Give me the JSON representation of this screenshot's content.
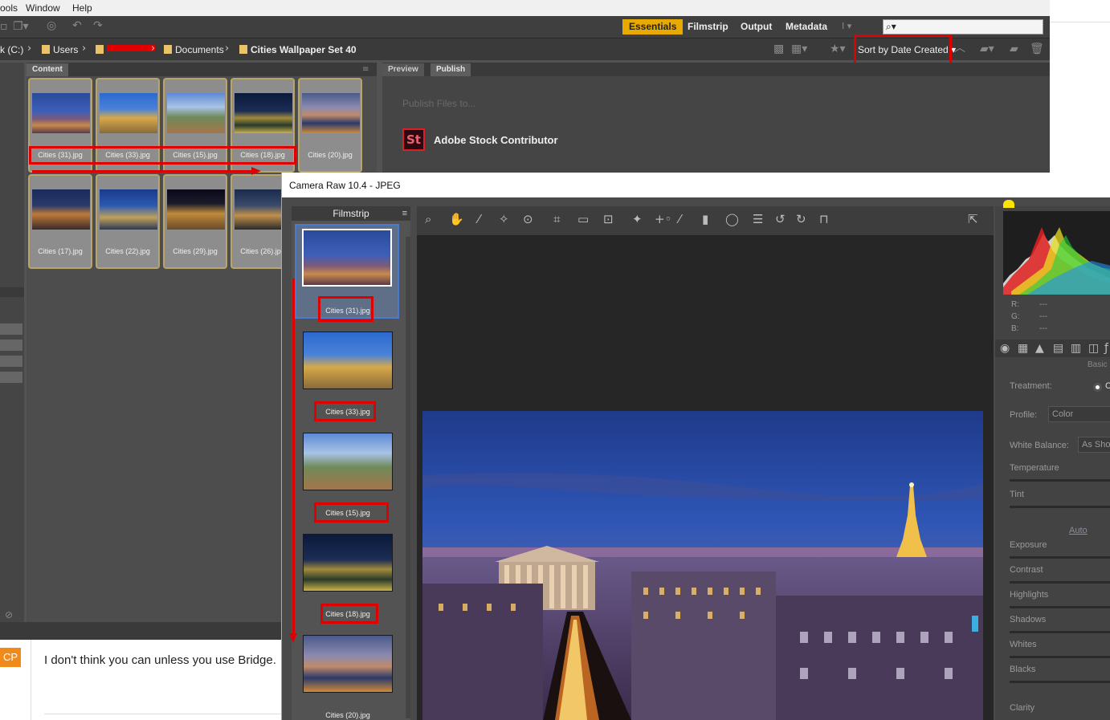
{
  "menu": {
    "items": [
      "ools",
      "Window",
      "Help"
    ]
  },
  "workspaces": {
    "active": "Essentials",
    "items": [
      "Essentials",
      "Filmstrip",
      "Output",
      "Metadata"
    ]
  },
  "breadcrumb": {
    "drive": "k (C:)",
    "users": "Users",
    "documents": "Documents",
    "folder": "Cities Wallpaper Set 40"
  },
  "sort": {
    "label": "Sort by Date Created"
  },
  "panels": {
    "content_tab": "Content",
    "preview_tab": "Preview",
    "publish_tab": "Publish"
  },
  "thumbnails": [
    "Cities  (31).jpg",
    "Cities  (33).jpg",
    "Cities  (15).jpg",
    "Cities  (18).jpg",
    "Cities  (20).jpg",
    "Cities  (17).jpg",
    "Cities  (22).jpg",
    "Cities  (29).jpg",
    "Cities  (26).jpg"
  ],
  "publish": {
    "publish_to": "Publish Files to...",
    "stock_icon": "St",
    "stock_name": "Adobe Stock Contributor"
  },
  "comment": {
    "avatar": "CP",
    "text": "I don't think you can unless you use Bridge."
  },
  "camera_raw": {
    "title": "Camera Raw 10.4  -  JPEG",
    "filmstrip_title": "Filmstrip",
    "filmstrip_items": [
      "Cities  (31).jpg",
      "Cities  (33).jpg",
      "Cities  (15).jpg",
      "Cities  (18).jpg",
      "Cities  (20).jpg"
    ],
    "rgb": {
      "r_label": "R:",
      "g_label": "G:",
      "b_label": "B:",
      "r": "---",
      "g": "---",
      "b": "---"
    },
    "panel_title": "Basic",
    "treatment_label": "Treatment:",
    "treatment_value": "Co",
    "profile_label": "Profile:",
    "profile_value": "Color",
    "wb_label": "White Balance:",
    "wb_value": "As Shot",
    "auto_label": "Auto",
    "sliders": [
      "Temperature",
      "Tint",
      "Exposure",
      "Contrast",
      "Highlights",
      "Shadows",
      "Whites",
      "Blacks",
      "Clarity"
    ]
  },
  "colors": {
    "accent": "#e8a900",
    "annotation": "#e00000",
    "stock_brand": "#da1f26"
  }
}
